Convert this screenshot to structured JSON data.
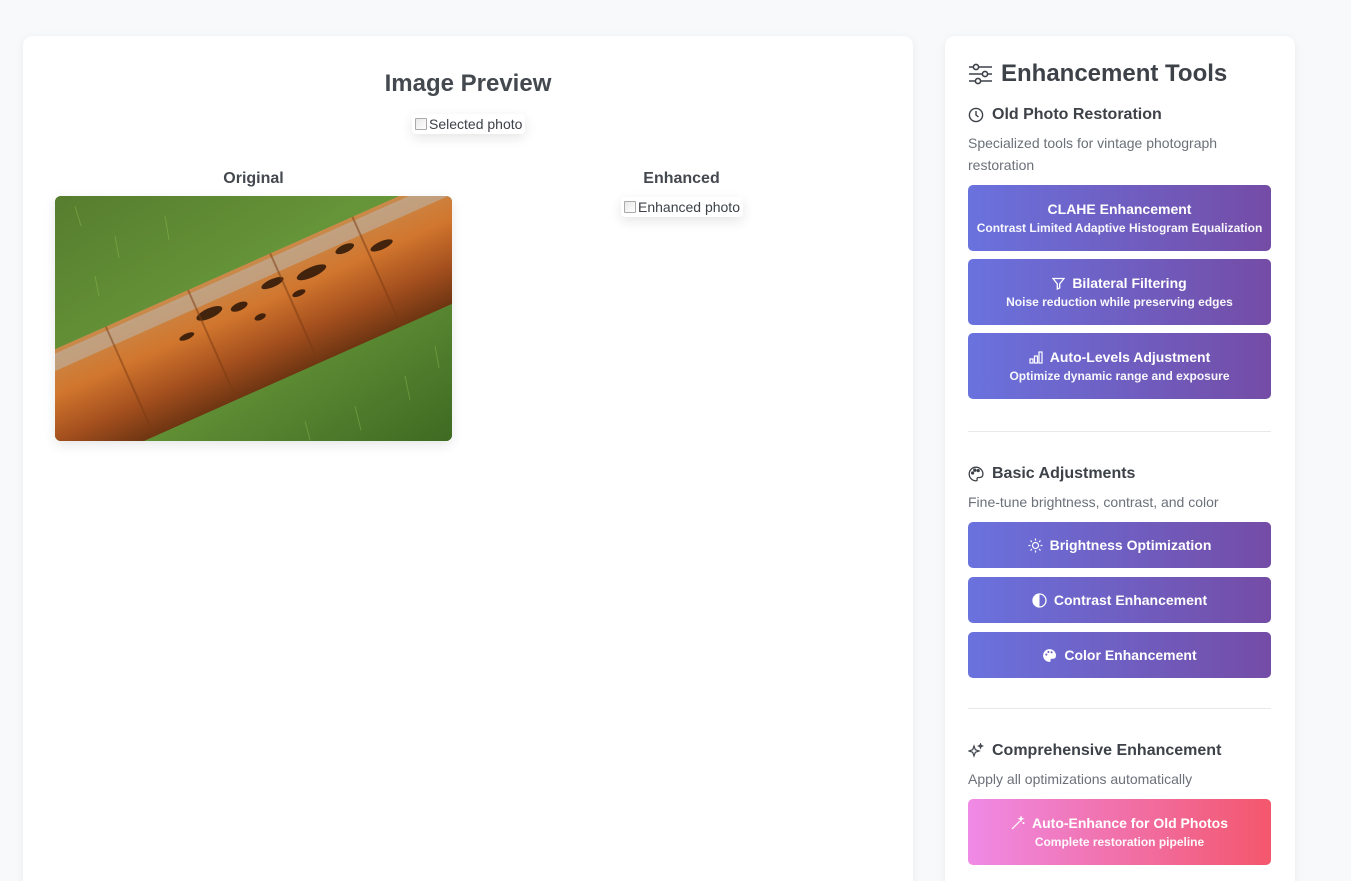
{
  "preview": {
    "title": "Image Preview",
    "selected_alt": "Selected photo",
    "original_label": "Original",
    "enhanced_label": "Enhanced",
    "enhanced_alt": "Enhanced photo"
  },
  "tools": {
    "title": "Enhancement Tools",
    "title_icon": "sliders-icon",
    "sections": [
      {
        "title": "Old Photo Restoration",
        "icon": "history-icon",
        "description": "Specialized tools for vintage photograph restoration",
        "buttons": [
          {
            "label": "CLAHE Enhancement",
            "sub": "Contrast Limited Adaptive Histogram Equalization",
            "icon": ""
          },
          {
            "label": "Bilateral Filtering",
            "sub": "Noise reduction while preserving edges",
            "icon": "filter-icon"
          },
          {
            "label": "Auto-Levels Adjustment",
            "sub": "Optimize dynamic range and exposure",
            "icon": "bar-chart-icon"
          }
        ]
      },
      {
        "title": "Basic Adjustments",
        "icon": "palette-icon",
        "description": "Fine-tune brightness, contrast, and color",
        "buttons": [
          {
            "label": "Brightness Optimization",
            "icon": "sun-icon"
          },
          {
            "label": "Contrast Enhancement",
            "icon": "half-circle-icon"
          },
          {
            "label": "Color Enhancement",
            "icon": "palette-icon"
          }
        ]
      },
      {
        "title": "Comprehensive Enhancement",
        "icon": "sparkles-icon",
        "description": "Apply all optimizations automatically",
        "buttons": [
          {
            "label": "Auto-Enhance for Old Photos",
            "sub": "Complete restoration pipeline",
            "icon": "magic-wand-icon"
          }
        ]
      }
    ]
  },
  "colors": {
    "button_gradient_start": "#6a72de",
    "button_gradient_end": "#744ca6",
    "pink_gradient_start": "#ef8ae6",
    "pink_gradient_end": "#f3576c",
    "page_background": "#f8f9fb"
  }
}
